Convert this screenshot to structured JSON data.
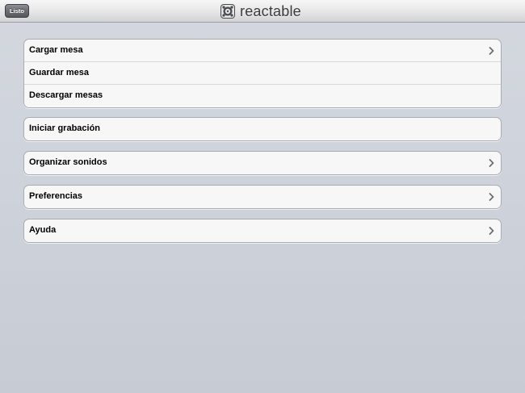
{
  "navbar": {
    "done_label": "Listo",
    "app_title": "reactable",
    "logo_icon": "reactable-logo-icon"
  },
  "groups": [
    {
      "items": [
        {
          "label": "Cargar mesa",
          "disclosure": true
        },
        {
          "label": "Guardar mesa",
          "disclosure": false
        },
        {
          "label": "Descargar mesas",
          "disclosure": false
        }
      ]
    },
    {
      "items": [
        {
          "label": "Iniciar grabación",
          "disclosure": false
        }
      ]
    },
    {
      "items": [
        {
          "label": "Organizar sonidos",
          "disclosure": true
        }
      ]
    },
    {
      "items": [
        {
          "label": "Preferencias",
          "disclosure": true
        }
      ]
    },
    {
      "items": [
        {
          "label": "Ayuda",
          "disclosure": true
        }
      ]
    }
  ],
  "colors": {
    "background": "#cfd3db",
    "cell_background": "#f7f7f7",
    "chevron": "#7a7a7a"
  }
}
